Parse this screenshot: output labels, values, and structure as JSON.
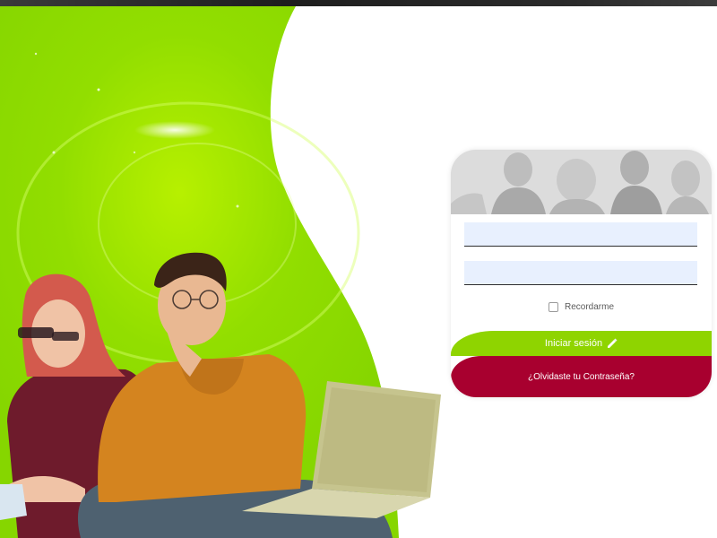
{
  "login": {
    "username_value": "",
    "password_value": "",
    "remember_label": "Recordarme",
    "remember_checked": false,
    "login_button_label": "Iniciar sesión",
    "forgot_password_label": "¿Olvidaste tu Contraseña?"
  },
  "colors": {
    "brand_green": "#8fd400",
    "brand_crimson": "#a8002f",
    "input_fill": "#e8f0fe"
  },
  "icons": {
    "login_button_icon": "pencil-icon"
  }
}
